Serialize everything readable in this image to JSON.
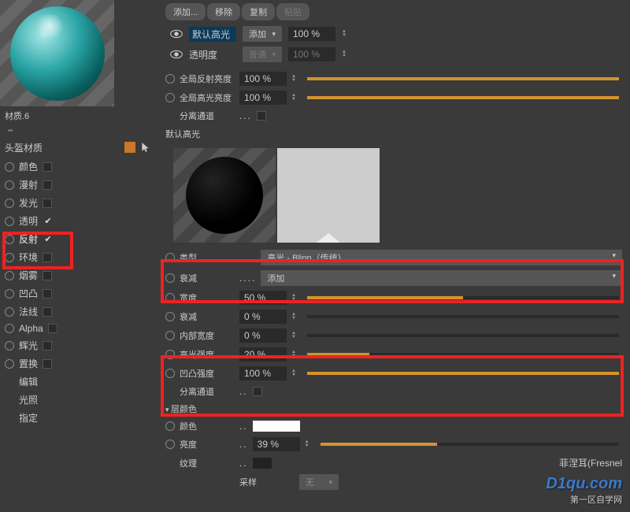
{
  "material": {
    "name": "材质.6",
    "channelHeader": "头盔材质"
  },
  "channels": [
    {
      "label": "颜色",
      "checked": false
    },
    {
      "label": "漫射",
      "checked": false
    },
    {
      "label": "发光",
      "checked": false
    },
    {
      "label": "透明",
      "checked": true
    },
    {
      "label": "反射",
      "checked": true
    },
    {
      "label": "环境",
      "checked": false
    },
    {
      "label": "烟雾",
      "checked": false
    },
    {
      "label": "凹凸",
      "checked": false
    },
    {
      "label": "法线",
      "checked": false
    },
    {
      "label": "Alpha",
      "checked": false
    },
    {
      "label": "辉光",
      "checked": false
    },
    {
      "label": "置换",
      "checked": false
    },
    {
      "label": "编辑",
      "checked": null
    },
    {
      "label": "光照",
      "checked": null
    },
    {
      "label": "指定",
      "checked": null
    }
  ],
  "toolbar": {
    "add": "添加...",
    "remove": "移除",
    "copy": "复制",
    "paste": "粘贴"
  },
  "layers": [
    {
      "name": "默认高光",
      "blend": "添加",
      "opacity": "100 %",
      "active": true
    },
    {
      "name": "透明度",
      "blend": "普通",
      "opacity": "100 %",
      "active": false
    }
  ],
  "globals": {
    "reflBrightness": {
      "label": "全局反射亮度",
      "value": "100 %",
      "fill": 100
    },
    "specBrightness": {
      "label": "全局高光亮度",
      "value": "100 %",
      "fill": 100
    },
    "separateChannel": "分离通道"
  },
  "activeLayer": "默认高光",
  "typeRow": {
    "label": "类型",
    "value": "高光 - Blinn（传统）"
  },
  "falloffRow": {
    "label": "衰减",
    "value": "添加"
  },
  "widthRow": {
    "label": "宽度",
    "value": "50 %",
    "fill": 50
  },
  "falloff2Row": {
    "label": "衰减",
    "value": "0 %",
    "fill": 0
  },
  "innerWidthRow": {
    "label": "内部宽度",
    "value": "0 %",
    "fill": 0
  },
  "specStrength": {
    "label": "高光强度",
    "value": "20 %",
    "fill": 20
  },
  "bumpStrength": {
    "label": "凹凸强度",
    "value": "100 %",
    "fill": 100
  },
  "separateChannel2": "分离通道",
  "layerColor": {
    "title": "层颜色",
    "colorLabel": "颜色",
    "brightLabel": "亮度",
    "brightValue": "39 %",
    "brightFill": 39,
    "textureLabel": "纹理",
    "fresnelLabel": "菲涅耳(Fresnel",
    "sampleLabel": "采样",
    "sampleValue": "无"
  },
  "watermark": {
    "main": "D1qu.com",
    "sub": "第一区自学网"
  }
}
